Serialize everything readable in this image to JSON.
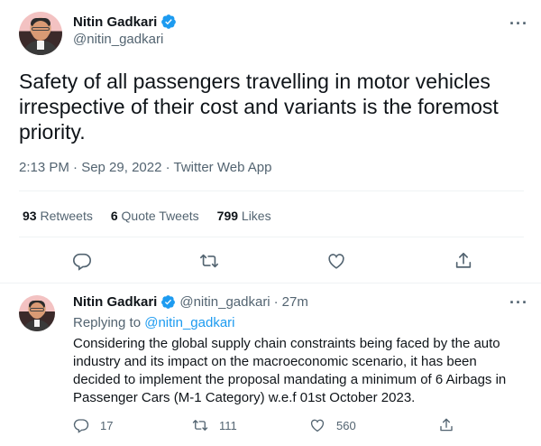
{
  "main_tweet": {
    "author_name": "Nitin Gadkari",
    "author_handle": "@nitin_gadkari",
    "more_label": "···",
    "text": "Safety of all passengers travelling in motor vehicles irrespective of their cost and variants is the foremost priority.",
    "text_lines": [
      "Safety of all passengers travelling in motor vehicles",
      "irrespective of their cost and variants is the foremost",
      "priority."
    ],
    "meta": "2:13 PM · Sep 29, 2022 · Twitter Web App",
    "stats": {
      "retweets_count": "93",
      "retweets_label": "Retweets",
      "quotes_count": "6",
      "quotes_label": "Quote Tweets",
      "likes_count": "799",
      "likes_label": "Likes"
    },
    "actions": [
      "reply-icon",
      "retweet-icon",
      "like-icon",
      "share-icon"
    ]
  },
  "reply_tweet": {
    "author_name": "Nitin Gadkari",
    "author_handle": "@nitin_gadkari",
    "separator": "·",
    "time": "27m",
    "more_label": "···",
    "replying_prefix": "Replying to",
    "replying_handle": "@nitin_gadkari",
    "text_lines": [
      "Considering the global supply chain constraints being faced by the auto",
      "industry and its impact on the macroeconomic scenario, it has been",
      "decided to implement the proposal mandating a minimum of 6 Airbags in",
      "Passenger Cars (M-1 Category) w.e.f 01st October 2023."
    ],
    "actions": {
      "reply_count": "17",
      "retweet_count": "111",
      "like_count": "560"
    }
  },
  "colors": {
    "accent": "#1d9bf0",
    "text_primary": "#0f1419",
    "text_secondary": "#536471",
    "divider": "#eff3f4"
  }
}
